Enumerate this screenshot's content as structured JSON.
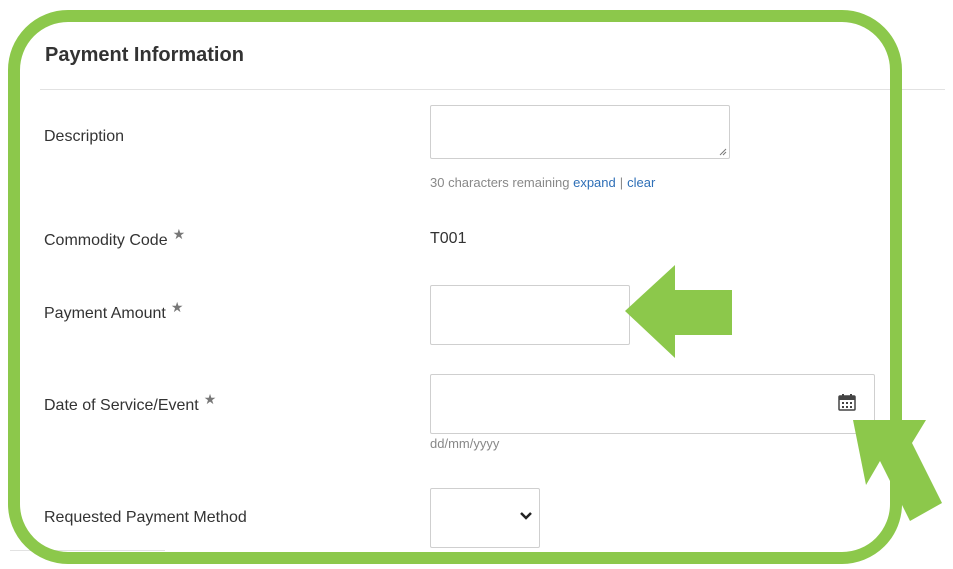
{
  "section": {
    "title": "Payment Information"
  },
  "fields": {
    "description": {
      "label": "Description",
      "value": "",
      "helper": "30 characters remaining",
      "expand_link": "expand",
      "separator": "|",
      "clear_link": "clear"
    },
    "commodity_code": {
      "label": "Commodity Code",
      "required": "★",
      "value": "T001"
    },
    "payment_amount": {
      "label": "Payment Amount",
      "required": "★",
      "value": ""
    },
    "date_of_service": {
      "label": "Date of Service/Event",
      "required": "★",
      "value": "",
      "format_hint": "dd/mm/yyyy",
      "icon": "calendar-icon"
    },
    "payment_method": {
      "label": "Requested Payment Method",
      "selected": "",
      "icon": "chevron-down-icon"
    }
  },
  "annotation": {
    "color": "#8cc84b"
  }
}
